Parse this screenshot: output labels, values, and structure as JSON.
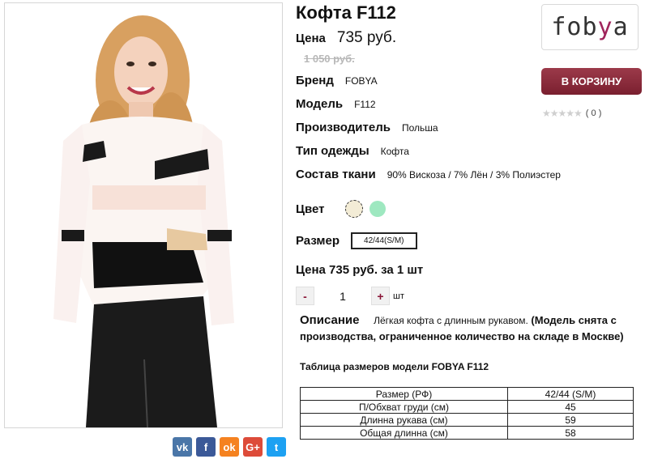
{
  "product": {
    "title": "Кофта F112",
    "price_label": "Цена",
    "price": "735 руб.",
    "old_price": "1 050 руб."
  },
  "brand_logo": {
    "text_main": "fob",
    "text_accent": "y",
    "text_end": "a"
  },
  "cart_button": "В КОРЗИНУ",
  "rating": {
    "stars": "★★★★★",
    "count": "( 0 )"
  },
  "attributes": [
    {
      "key": "Бренд",
      "value": "FOBYA"
    },
    {
      "key": "Модель",
      "value": "F112"
    },
    {
      "key": "Производитель",
      "value": "Польша"
    },
    {
      "key": "Тип одежды",
      "value": "Кофта"
    },
    {
      "key": "Состав ткани",
      "value": "90% Вискоза / 7% Лён / 3% Полиэстер"
    }
  ],
  "color": {
    "label": "Цвет",
    "options": [
      "#f3ecd6",
      "#9ee8c0"
    ]
  },
  "size": {
    "label": "Размер",
    "selected": "42/44(S/M)"
  },
  "price_per_qty": "Цена 735 руб. за 1 шт",
  "quantity": {
    "minus": "-",
    "value": "1",
    "plus": "+",
    "unit": "шт"
  },
  "description": {
    "label": "Описание",
    "text": "Лёгкая кофта с длинным рукавом.",
    "note": "(Модель снята с производства, ограниченное количество на складе в Москве)"
  },
  "size_table": {
    "title": "Таблица размеров модели FOBYA F112",
    "header": [
      "Размер (РФ)",
      "42/44 (S/M)"
    ],
    "rows": [
      [
        "П/Обхват груди (см)",
        "45"
      ],
      [
        "Длинна рукава (см)",
        "59"
      ],
      [
        "Общая длинна (см)",
        "58"
      ]
    ]
  },
  "share": [
    {
      "name": "vk",
      "label": "vk",
      "color": "#4a76a8"
    },
    {
      "name": "facebook",
      "label": "f",
      "color": "#3b5998"
    },
    {
      "name": "odnoklassniki",
      "label": "ok",
      "color": "#f58220"
    },
    {
      "name": "google-plus",
      "label": "G+",
      "color": "#dd4b39"
    },
    {
      "name": "twitter",
      "label": "t",
      "color": "#1da1f2"
    }
  ]
}
